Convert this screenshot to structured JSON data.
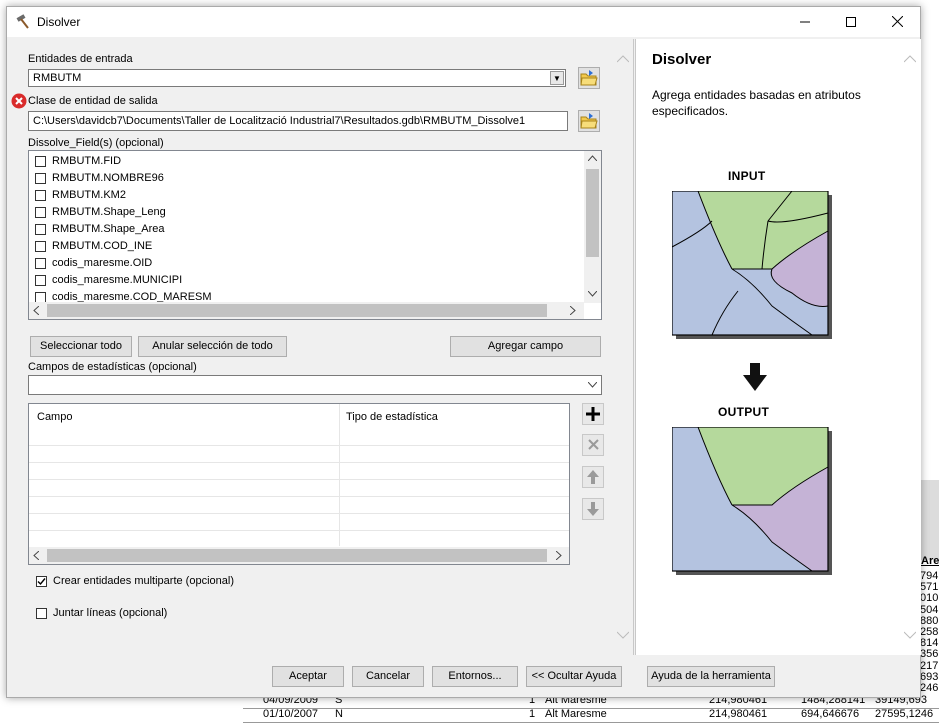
{
  "window": {
    "title": "Disolver",
    "minimize": "—",
    "maximize": "☐",
    "close": "✕"
  },
  "form": {
    "input_label": "Entidades de entrada",
    "input_value": "RMBUTM",
    "output_label": "Clase de entidad de salida",
    "output_value": "C:\\Users\\davidcb7\\Documents\\Taller de Localització Industrial7\\Resultados.gdb\\RMBUTM_Dissolve1",
    "dissolve_label": "Dissolve_Field(s) (opcional)",
    "fields": [
      "RMBUTM.FID",
      "RMBUTM.NOMBRE96",
      "RMBUTM.KM2",
      "RMBUTM.Shape_Leng",
      "RMBUTM.Shape_Area",
      "RMBUTM.COD_INE",
      "codis_maresme.OID",
      "codis_maresme.MUNICIPI",
      "codis_maresme.COD_MARESM"
    ],
    "select_all": "Seleccionar todo",
    "unselect_all": "Anular selección de todo",
    "add_field": "Agregar campo",
    "stats_label": "Campos de estadísticas (opcional)",
    "stats_col_field": "Campo",
    "stats_col_type": "Tipo de estadística",
    "multipart_label": "Crear entidades multiparte (opcional)",
    "multipart_checked": true,
    "unsplit_label": "Juntar líneas (opcional)",
    "unsplit_checked": false
  },
  "help": {
    "title": "Disolver",
    "description": "Agrega entidades basadas en atributos especificados.",
    "input_caption": "INPUT",
    "output_caption": "OUTPUT",
    "colors": {
      "blue": "#b4c3e0",
      "green": "#b5d99c",
      "purple": "#c5b3d6"
    }
  },
  "footer": {
    "ok": "Aceptar",
    "cancel": "Cancelar",
    "env": "Entornos...",
    "hide_help": "<< Ocultar Ayuda",
    "tool_help": "Ayuda de la herramienta"
  },
  "background": {
    "col_head": "Are",
    "right_values": [
      "794",
      "571",
      "010",
      "504",
      "880",
      "258",
      "814",
      "356",
      "217",
      "693",
      "246"
    ],
    "rows": [
      {
        "date": "04/09/2009",
        "c": "S",
        "n": "1",
        "name": "Alt Maresme",
        "v1": "214,980461",
        "v2": "1484,288141",
        "v3": "39149,693"
      },
      {
        "date": "01/10/2007",
        "c": "N",
        "n": "1",
        "name": "Alt Maresme",
        "v1": "214,980461",
        "v2": "694,646676",
        "v3": "27595,1246"
      }
    ]
  }
}
